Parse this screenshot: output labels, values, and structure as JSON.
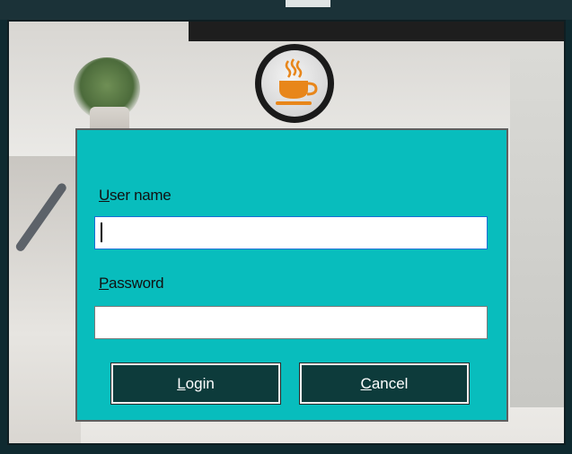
{
  "login_dialog": {
    "logo_icon": "coffee-cup-icon",
    "username": {
      "label_first": "U",
      "label_rest": "ser name",
      "value": ""
    },
    "password": {
      "label_first": "P",
      "label_rest": "assword",
      "value": ""
    },
    "login_button": {
      "first": "L",
      "rest": "ogin"
    },
    "cancel_button": {
      "first": "C",
      "rest": "ancel"
    }
  },
  "colors": {
    "panel": "#08bdbd",
    "button": "#0d3b3b",
    "cup": "#e8861a"
  }
}
